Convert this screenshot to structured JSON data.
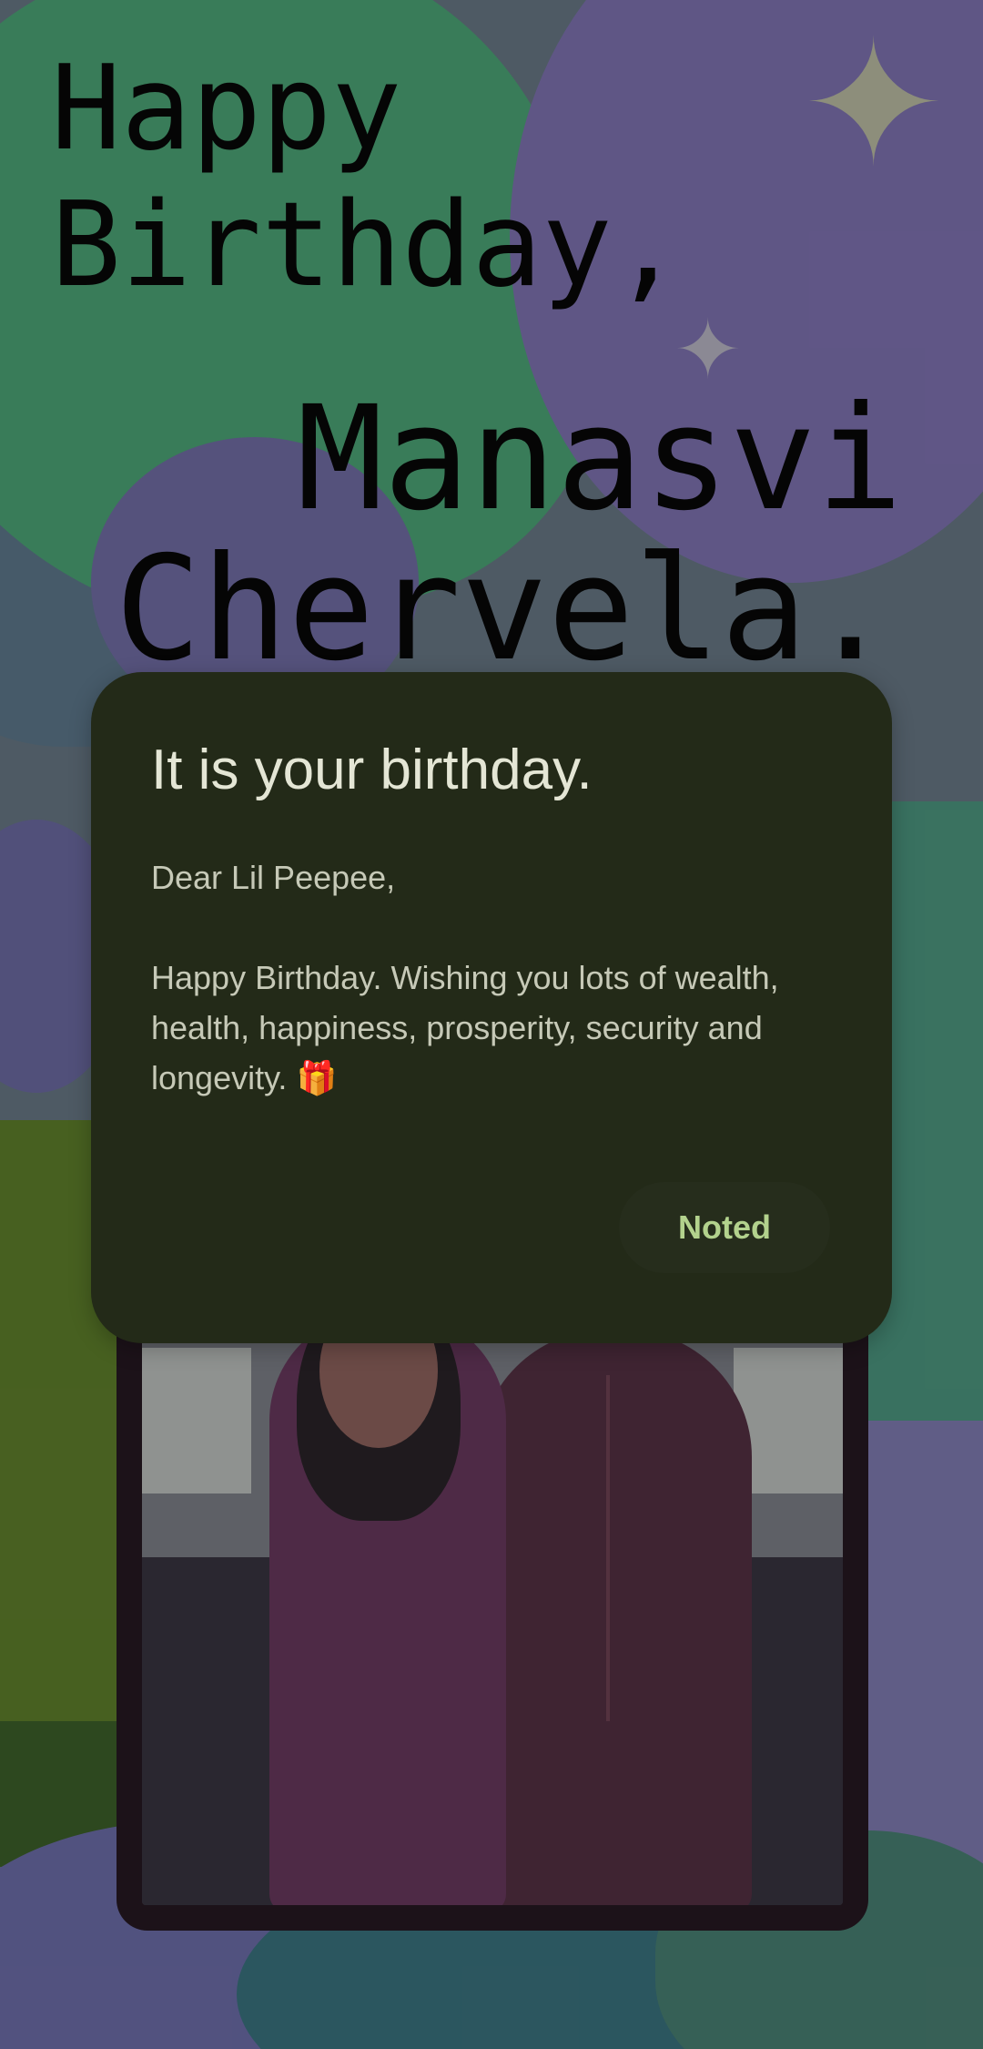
{
  "headline": {
    "line1": "Happy",
    "line2": "Birthday,",
    "first_name": "Manasvi",
    "last_name": "Chervela."
  },
  "dialog": {
    "title": "It is your birthday.",
    "greeting": "Dear Lil Peepee,",
    "message": "Happy Birthday. Wishing you lots of wealth, health, happiness, prosperity, security and longevity.",
    "message_emoji": "🎁",
    "confirm_button": "Noted"
  },
  "icons": {
    "sparkle": "sparkle-icon",
    "gift": "gift-icon"
  },
  "colors": {
    "dialog_background": "#232a18",
    "dialog_title": "#e4e6d5",
    "dialog_text": "#c6c9b7",
    "button_text": "#b3d28d"
  }
}
